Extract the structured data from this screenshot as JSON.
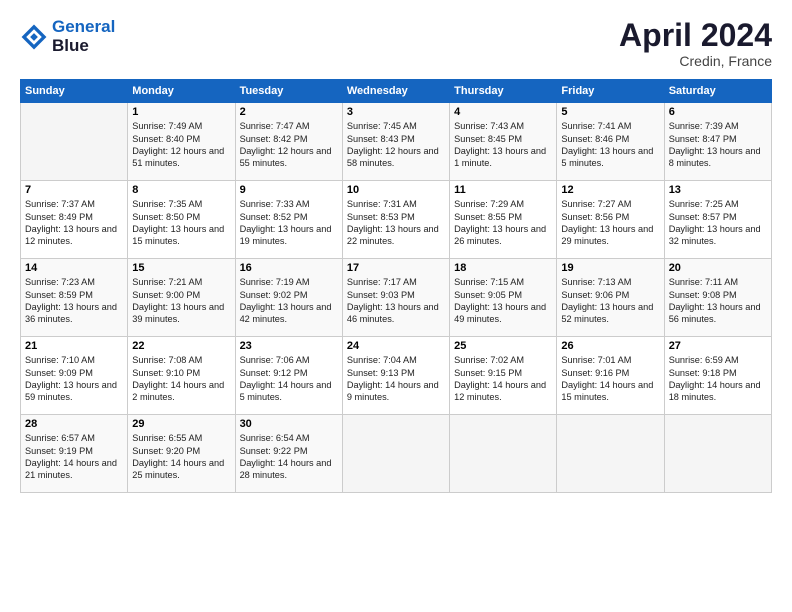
{
  "header": {
    "logo_line1": "General",
    "logo_line2": "Blue",
    "month_title": "April 2024",
    "location": "Credin, France"
  },
  "days_of_week": [
    "Sunday",
    "Monday",
    "Tuesday",
    "Wednesday",
    "Thursday",
    "Friday",
    "Saturday"
  ],
  "weeks": [
    [
      {
        "num": "",
        "empty": true
      },
      {
        "num": "1",
        "sunrise": "7:49 AM",
        "sunset": "8:40 PM",
        "daylight": "12 hours and 51 minutes."
      },
      {
        "num": "2",
        "sunrise": "7:47 AM",
        "sunset": "8:42 PM",
        "daylight": "12 hours and 55 minutes."
      },
      {
        "num": "3",
        "sunrise": "7:45 AM",
        "sunset": "8:43 PM",
        "daylight": "12 hours and 58 minutes."
      },
      {
        "num": "4",
        "sunrise": "7:43 AM",
        "sunset": "8:45 PM",
        "daylight": "13 hours and 1 minute."
      },
      {
        "num": "5",
        "sunrise": "7:41 AM",
        "sunset": "8:46 PM",
        "daylight": "13 hours and 5 minutes."
      },
      {
        "num": "6",
        "sunrise": "7:39 AM",
        "sunset": "8:47 PM",
        "daylight": "13 hours and 8 minutes."
      }
    ],
    [
      {
        "num": "7",
        "sunrise": "7:37 AM",
        "sunset": "8:49 PM",
        "daylight": "13 hours and 12 minutes."
      },
      {
        "num": "8",
        "sunrise": "7:35 AM",
        "sunset": "8:50 PM",
        "daylight": "13 hours and 15 minutes."
      },
      {
        "num": "9",
        "sunrise": "7:33 AM",
        "sunset": "8:52 PM",
        "daylight": "13 hours and 19 minutes."
      },
      {
        "num": "10",
        "sunrise": "7:31 AM",
        "sunset": "8:53 PM",
        "daylight": "13 hours and 22 minutes."
      },
      {
        "num": "11",
        "sunrise": "7:29 AM",
        "sunset": "8:55 PM",
        "daylight": "13 hours and 26 minutes."
      },
      {
        "num": "12",
        "sunrise": "7:27 AM",
        "sunset": "8:56 PM",
        "daylight": "13 hours and 29 minutes."
      },
      {
        "num": "13",
        "sunrise": "7:25 AM",
        "sunset": "8:57 PM",
        "daylight": "13 hours and 32 minutes."
      }
    ],
    [
      {
        "num": "14",
        "sunrise": "7:23 AM",
        "sunset": "8:59 PM",
        "daylight": "13 hours and 36 minutes."
      },
      {
        "num": "15",
        "sunrise": "7:21 AM",
        "sunset": "9:00 PM",
        "daylight": "13 hours and 39 minutes."
      },
      {
        "num": "16",
        "sunrise": "7:19 AM",
        "sunset": "9:02 PM",
        "daylight": "13 hours and 42 minutes."
      },
      {
        "num": "17",
        "sunrise": "7:17 AM",
        "sunset": "9:03 PM",
        "daylight": "13 hours and 46 minutes."
      },
      {
        "num": "18",
        "sunrise": "7:15 AM",
        "sunset": "9:05 PM",
        "daylight": "13 hours and 49 minutes."
      },
      {
        "num": "19",
        "sunrise": "7:13 AM",
        "sunset": "9:06 PM",
        "daylight": "13 hours and 52 minutes."
      },
      {
        "num": "20",
        "sunrise": "7:11 AM",
        "sunset": "9:08 PM",
        "daylight": "13 hours and 56 minutes."
      }
    ],
    [
      {
        "num": "21",
        "sunrise": "7:10 AM",
        "sunset": "9:09 PM",
        "daylight": "13 hours and 59 minutes."
      },
      {
        "num": "22",
        "sunrise": "7:08 AM",
        "sunset": "9:10 PM",
        "daylight": "14 hours and 2 minutes."
      },
      {
        "num": "23",
        "sunrise": "7:06 AM",
        "sunset": "9:12 PM",
        "daylight": "14 hours and 5 minutes."
      },
      {
        "num": "24",
        "sunrise": "7:04 AM",
        "sunset": "9:13 PM",
        "daylight": "14 hours and 9 minutes."
      },
      {
        "num": "25",
        "sunrise": "7:02 AM",
        "sunset": "9:15 PM",
        "daylight": "14 hours and 12 minutes."
      },
      {
        "num": "26",
        "sunrise": "7:01 AM",
        "sunset": "9:16 PM",
        "daylight": "14 hours and 15 minutes."
      },
      {
        "num": "27",
        "sunrise": "6:59 AM",
        "sunset": "9:18 PM",
        "daylight": "14 hours and 18 minutes."
      }
    ],
    [
      {
        "num": "28",
        "sunrise": "6:57 AM",
        "sunset": "9:19 PM",
        "daylight": "14 hours and 21 minutes."
      },
      {
        "num": "29",
        "sunrise": "6:55 AM",
        "sunset": "9:20 PM",
        "daylight": "14 hours and 25 minutes."
      },
      {
        "num": "30",
        "sunrise": "6:54 AM",
        "sunset": "9:22 PM",
        "daylight": "14 hours and 28 minutes."
      },
      {
        "num": "",
        "empty": true
      },
      {
        "num": "",
        "empty": true
      },
      {
        "num": "",
        "empty": true
      },
      {
        "num": "",
        "empty": true
      }
    ]
  ]
}
